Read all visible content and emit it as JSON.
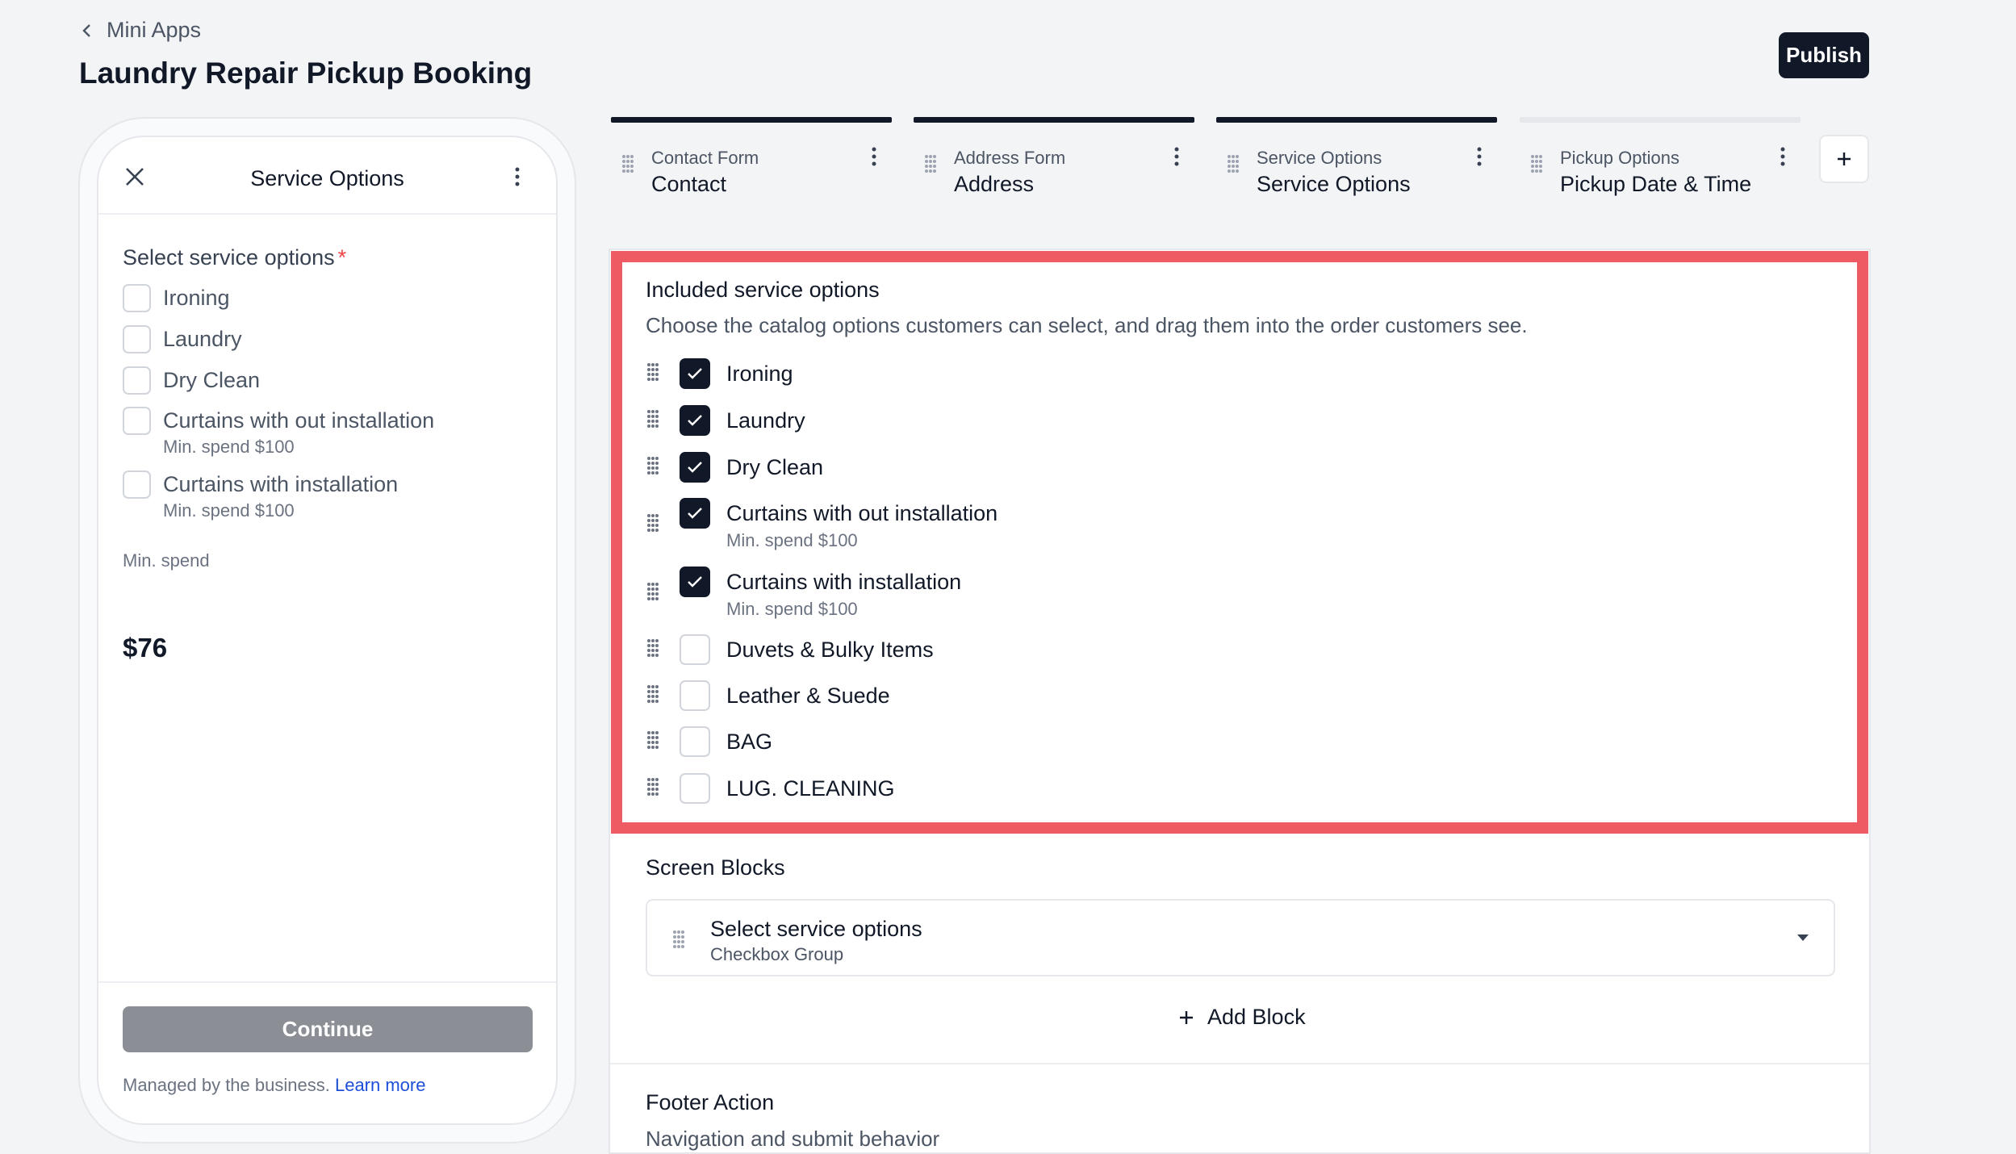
{
  "header": {
    "back_label": "Mini Apps",
    "title": "Laundry Repair Pickup Booking",
    "publish_label": "Publish"
  },
  "preview": {
    "title": "Service Options",
    "field_label": "Select service options",
    "required_mark": "*",
    "options": [
      {
        "label": "Ironing",
        "sub": ""
      },
      {
        "label": "Laundry",
        "sub": ""
      },
      {
        "label": "Dry Clean",
        "sub": ""
      },
      {
        "label": "Curtains with out installation",
        "sub": "Min. spend $100"
      },
      {
        "label": "Curtains with installation",
        "sub": "Min. spend $100"
      }
    ],
    "min_spend_label": "Min. spend",
    "price": "$76",
    "continue_label": "Continue",
    "managed_text": "Managed by the business.",
    "learn_more": "Learn more"
  },
  "tabs": [
    {
      "caption": "Contact Form",
      "name": "Contact",
      "active": true
    },
    {
      "caption": "Address Form",
      "name": "Address",
      "active": true
    },
    {
      "caption": "Service Options",
      "name": "Service Options",
      "active": true
    },
    {
      "caption": "Pickup Options",
      "name": "Pickup Date & Time",
      "active": false
    }
  ],
  "included": {
    "title": "Included service options",
    "description": "Choose the catalog options customers can select, and drag them into the order customers see.",
    "options": [
      {
        "label": "Ironing",
        "sub": "",
        "checked": true
      },
      {
        "label": "Laundry",
        "sub": "",
        "checked": true
      },
      {
        "label": "Dry Clean",
        "sub": "",
        "checked": true
      },
      {
        "label": "Curtains with out installation",
        "sub": "Min. spend $100",
        "checked": true
      },
      {
        "label": "Curtains with installation",
        "sub": "Min. spend $100",
        "checked": true
      },
      {
        "label": "Duvets & Bulky Items",
        "sub": "",
        "checked": false
      },
      {
        "label": "Leather & Suede",
        "sub": "",
        "checked": false
      },
      {
        "label": "BAG",
        "sub": "",
        "checked": false
      },
      {
        "label": "LUG. CLEANING",
        "sub": "",
        "checked": false
      }
    ]
  },
  "screen_blocks": {
    "title": "Screen Blocks",
    "block_title": "Select service options",
    "block_type": "Checkbox Group",
    "add_block_label": "Add Block"
  },
  "footer_action": {
    "title": "Footer Action",
    "description": "Navigation and submit behavior"
  },
  "colors": {
    "dark": "#111827",
    "highlight": "#ef5b62",
    "link": "#1d4ed8",
    "required": "#ef4444"
  }
}
